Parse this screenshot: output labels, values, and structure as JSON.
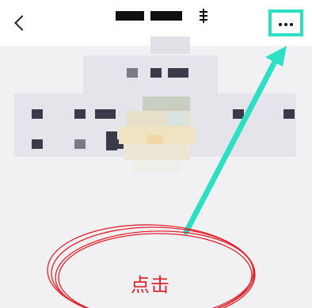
{
  "nav": {
    "back_icon": "chevron-left-icon",
    "more_icon": "more-dots-icon"
  },
  "annotation": {
    "tap_label": "点击",
    "highlight_color": "#2de0c4",
    "ellipse_color": "#e0222c"
  }
}
